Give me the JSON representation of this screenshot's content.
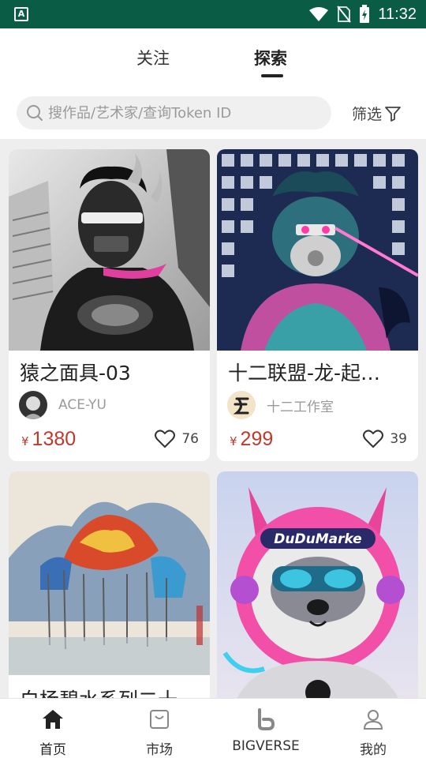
{
  "status": {
    "time": "11:32"
  },
  "tabs": [
    {
      "label": "关注"
    },
    {
      "label": "探索"
    }
  ],
  "search": {
    "placeholder": "搜作品/艺术家/查询Token ID"
  },
  "filter": {
    "label": "筛选"
  },
  "cards": [
    {
      "title": "猿之面具-03",
      "artist": "ACE-YU",
      "currency": "¥",
      "price": "1380",
      "likes": "76"
    },
    {
      "title": "十二联盟-龙-起…",
      "artist": "十二工作室",
      "currency": "¥",
      "price": "299",
      "likes": "39"
    },
    {
      "title": "白杨碧水系列二十",
      "artist": "",
      "currency": "",
      "price": "",
      "likes": ""
    },
    {
      "title": "",
      "artist": "",
      "currency": "",
      "price": "",
      "likes": ""
    }
  ],
  "art_text": {
    "dudu_visor": "DuDuMarke"
  },
  "nav": [
    {
      "label": "首页",
      "icon": "home-icon"
    },
    {
      "label": "市场",
      "icon": "bag-icon"
    },
    {
      "label": "BIGVERSE",
      "icon": "bigverse-icon"
    },
    {
      "label": "我的",
      "icon": "user-icon"
    }
  ],
  "colors": {
    "statusbar": "#0b5c45",
    "price": "#c0392b"
  }
}
